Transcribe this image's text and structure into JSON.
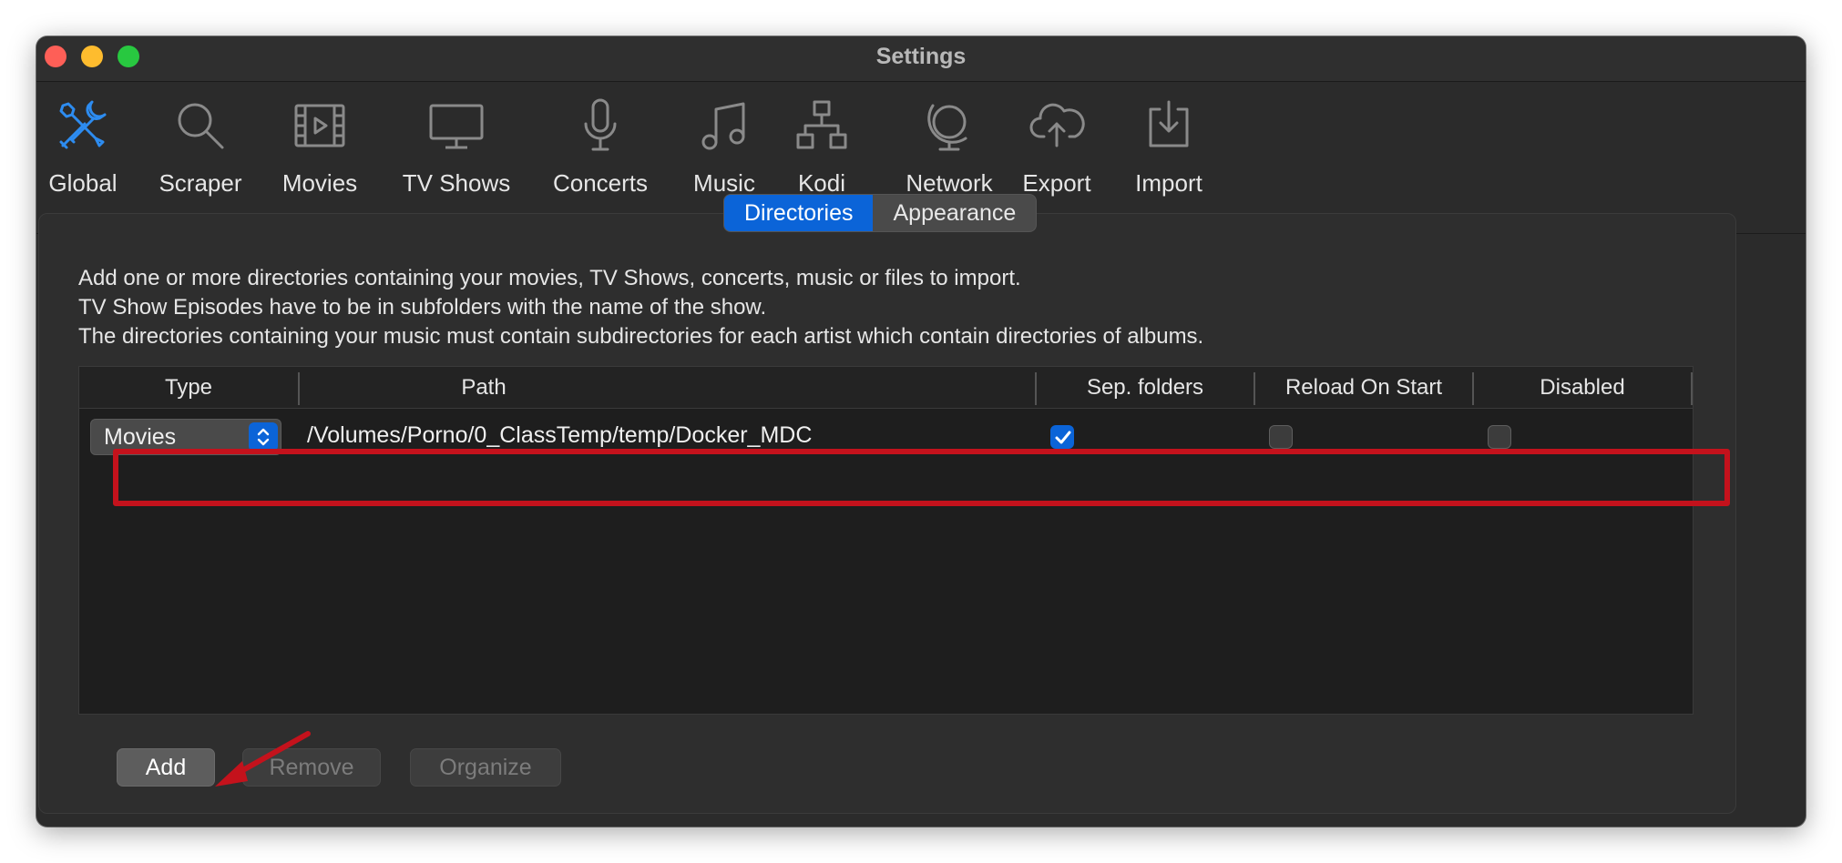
{
  "window": {
    "title": "Settings"
  },
  "toolbar": {
    "items": [
      {
        "label": "Global",
        "icon": "tools-icon",
        "active": true
      },
      {
        "label": "Scraper",
        "icon": "magnifier-icon"
      },
      {
        "label": "Movies",
        "icon": "film-icon"
      },
      {
        "label": "TV Shows",
        "icon": "monitor-icon"
      },
      {
        "label": "Concerts",
        "icon": "microphone-icon"
      },
      {
        "label": "Music",
        "icon": "music-note-icon"
      },
      {
        "label": "Kodi",
        "icon": "hierarchy-icon"
      },
      {
        "label": "Network",
        "icon": "globe-icon"
      },
      {
        "label": "Export",
        "icon": "cloud-upload-icon"
      },
      {
        "label": "Import",
        "icon": "download-icon"
      }
    ]
  },
  "tabs": [
    {
      "label": "Directories",
      "active": true
    },
    {
      "label": "Appearance",
      "active": false
    }
  ],
  "description": {
    "line1": "Add one or more directories containing your movies, TV Shows, concerts, music or files to import.",
    "line2": "TV Show Episodes have to be in subfolders with the name of the show.",
    "line3": "The directories containing your music must contain subdirectories for each artist which contain directories of albums."
  },
  "table": {
    "columns": [
      "Type",
      "Path",
      "Sep. folders",
      "Reload On Start",
      "Disabled"
    ],
    "rows": [
      {
        "type": "Movies",
        "path": "/Volumes/Porno/0_ClassTemp/temp/Docker_MDC",
        "sep_folders": true,
        "reload_on_start": false,
        "disabled": false
      }
    ]
  },
  "buttons": {
    "add": "Add",
    "remove": "Remove",
    "organize": "Organize"
  },
  "colors": {
    "accent": "#0b64d8",
    "highlight": "#c4121c",
    "window_bg": "#2b2b2b"
  }
}
